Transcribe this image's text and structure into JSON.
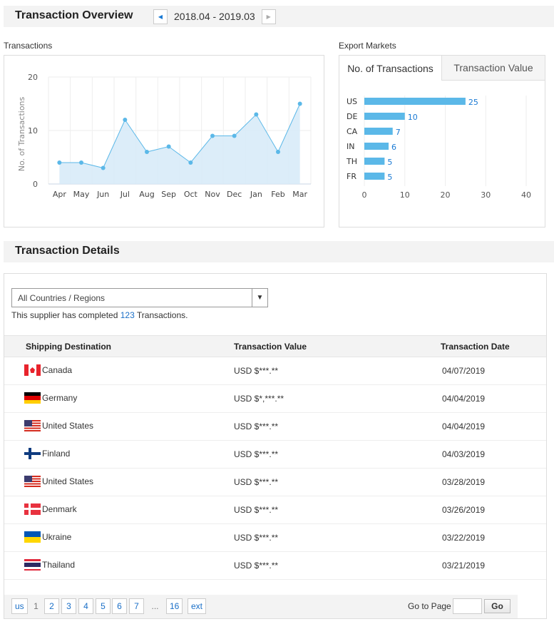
{
  "overview": {
    "title": "Transaction Overview",
    "date_range": "2018.04 - 2019.03",
    "prev_icon": "caret-left-icon",
    "next_icon": "caret-right-icon"
  },
  "transactions_panel": {
    "label": "Transactions"
  },
  "export_panel": {
    "label": "Export Markets",
    "tabs": [
      {
        "label": "No. of Transactions",
        "active": true
      },
      {
        "label": "Transaction Value",
        "active": false
      }
    ]
  },
  "chart_data": [
    {
      "type": "area",
      "title": "Transactions",
      "xlabel": "",
      "ylabel": "No. of Transactions",
      "categories": [
        "Apr",
        "May",
        "Jun",
        "Jul",
        "Aug",
        "Sep",
        "Oct",
        "Nov",
        "Dec",
        "Jan",
        "Feb",
        "Mar"
      ],
      "values": [
        4,
        4,
        3,
        12,
        6,
        7,
        4,
        9,
        9,
        13,
        6,
        15
      ],
      "ylim": [
        0,
        20
      ],
      "yticks": [
        0,
        10,
        20
      ],
      "grid": true,
      "color": "#5bb8e8"
    },
    {
      "type": "bar",
      "orientation": "horizontal",
      "title": "Export Markets - No. of Transactions",
      "categories": [
        "US",
        "DE",
        "CA",
        "IN",
        "TH",
        "FR"
      ],
      "values": [
        25,
        10,
        7,
        6,
        5,
        5
      ],
      "xlim": [
        0,
        40
      ],
      "xticks": [
        0,
        10,
        20,
        30,
        40
      ],
      "grid": true,
      "color": "#5bb8e8",
      "label_color": "#1a7ad4"
    }
  ],
  "details": {
    "title": "Transaction Details",
    "filter": {
      "selected": "All Countries / Regions"
    },
    "summary_prefix": "This supplier has completed ",
    "summary_count": "123",
    "summary_suffix": " Transactions.",
    "columns": [
      "Shipping Destination",
      "Transaction Value",
      "Transaction Date"
    ],
    "rows": [
      {
        "flag": "ca",
        "country": "Canada",
        "value": "USD $***.**",
        "date": "04/07/2019"
      },
      {
        "flag": "de",
        "country": "Germany",
        "value": "USD $*,***.**",
        "date": "04/04/2019"
      },
      {
        "flag": "us",
        "country": "United States",
        "value": "USD $***.**",
        "date": "04/04/2019"
      },
      {
        "flag": "fi",
        "country": "Finland",
        "value": "USD $***.**",
        "date": "04/03/2019"
      },
      {
        "flag": "us",
        "country": "United States",
        "value": "USD $***.**",
        "date": "03/28/2019"
      },
      {
        "flag": "dk",
        "country": "Denmark",
        "value": "USD $***.**",
        "date": "03/26/2019"
      },
      {
        "flag": "ua",
        "country": "Ukraine",
        "value": "USD $***.**",
        "date": "03/22/2019"
      },
      {
        "flag": "th",
        "country": "Thailand",
        "value": "USD $***.**",
        "date": "03/21/2019"
      }
    ],
    "pagination": {
      "prev_label": "us",
      "current": "1",
      "pages": [
        "2",
        "3",
        "4",
        "5",
        "6",
        "7"
      ],
      "ellipsis": "...",
      "last": "16",
      "next_label": "ext",
      "goto_label": "Go to Page",
      "goto_value": "",
      "go_label": "Go"
    }
  }
}
